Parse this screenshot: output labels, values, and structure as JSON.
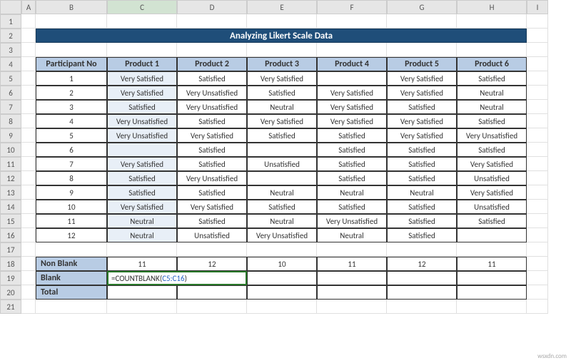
{
  "columns": [
    "A",
    "B",
    "C",
    "D",
    "E",
    "F",
    "G",
    "H",
    "I"
  ],
  "rows": [
    "1",
    "2",
    "3",
    "4",
    "5",
    "6",
    "7",
    "8",
    "9",
    "10",
    "11",
    "12",
    "13",
    "14",
    "15",
    "16",
    "17",
    "18",
    "19",
    "20",
    "21"
  ],
  "title": "Analyzing Likert Scale Data",
  "headers": {
    "participant": "Participant No",
    "p1": "Product 1",
    "p2": "Product 2",
    "p3": "Product 3",
    "p4": "Product 4",
    "p5": "Product 5",
    "p6": "Product 6"
  },
  "table": [
    {
      "n": "1",
      "c": [
        "Very Satisfied",
        "Satisfied",
        "Very Satisfied",
        "",
        "Very Satisfied",
        "Satisfied"
      ]
    },
    {
      "n": "2",
      "c": [
        "Very Satisfied",
        "Very Unsatisfied",
        "Satisfied",
        "Very Satisfied",
        "Very Satisfied",
        "Neutral"
      ]
    },
    {
      "n": "3",
      "c": [
        "Satisfied",
        "Very Unsatisfied",
        "Neutral",
        "Very Satisfied",
        "Satisfied",
        "Neutral"
      ]
    },
    {
      "n": "4",
      "c": [
        "Very Unsatisfied",
        "Satisfied",
        "Very Satisfied",
        "Very Satisfied",
        "Very Satisfied",
        "Satisfied"
      ]
    },
    {
      "n": "5",
      "c": [
        "Very Unsatisfied",
        "Very Satisfied",
        "Satisfied",
        "Satisfied",
        "Very Satisfied",
        "Very Unsatisfied"
      ]
    },
    {
      "n": "6",
      "c": [
        "",
        "Satisfied",
        "",
        "Satisfied",
        "Satisfied",
        "Satisfied"
      ]
    },
    {
      "n": "7",
      "c": [
        "Very Satisfied",
        "Satisfied",
        "Unsatisfied",
        "Satisfied",
        "Satisfied",
        "Very Satisfied"
      ]
    },
    {
      "n": "8",
      "c": [
        "Satisfied",
        "Very Unsatisfied",
        "",
        "Satisfied",
        "Satisfied",
        "Unsatisfied"
      ]
    },
    {
      "n": "9",
      "c": [
        "Satisfied",
        "Satisfied",
        "Neutral",
        "Neutral",
        "Neutral",
        "Very Satisfied"
      ]
    },
    {
      "n": "10",
      "c": [
        "Very Satisfied",
        "Very Satisfied",
        "Satisfied",
        "Satisfied",
        "Satisfied",
        "Unsatisfied"
      ]
    },
    {
      "n": "11",
      "c": [
        "Neutral",
        "Satisfied",
        "Neutral",
        "Very Unsatisfied",
        "Satisfied",
        "Satisfied"
      ]
    },
    {
      "n": "12",
      "c": [
        "Neutral",
        "Unsatisfied",
        "Very Unsatisfied",
        "Neutral",
        "Satisfied",
        ""
      ]
    }
  ],
  "summary": {
    "nonblank_label": "Non Blank",
    "blank_label": "Blank",
    "total_label": "Total",
    "nonblank": [
      "11",
      "12",
      "10",
      "11",
      "12",
      "11"
    ]
  },
  "formula": {
    "prefix": "=COUNTBLANK(",
    "ref": "C5:C16",
    "suffix": ")"
  },
  "watermark": "wsxdn.com",
  "selected_col": "C"
}
